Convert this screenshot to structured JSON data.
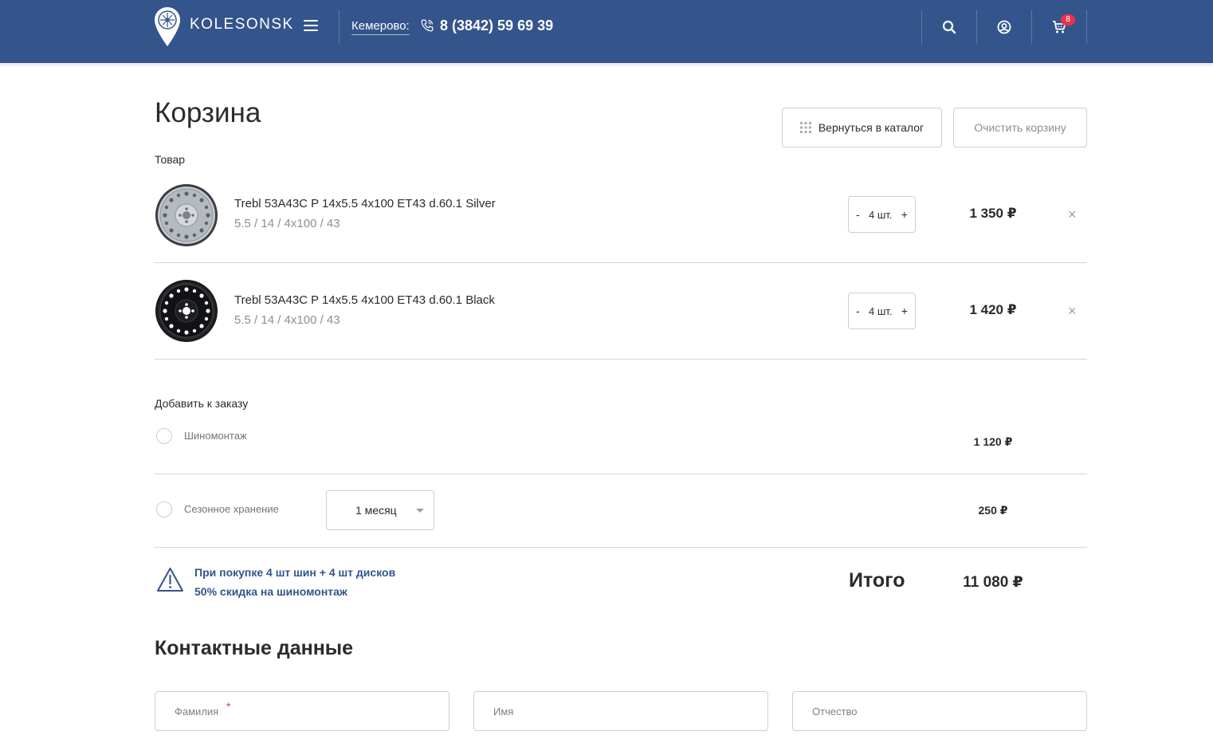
{
  "header": {
    "logo_text": "KOLESONSK",
    "city": "Кемерово:",
    "phone": "8 (3842) 59 69 39",
    "cart_count": "8"
  },
  "page": {
    "title": "Корзина",
    "back_button": "Вернуться в каталог",
    "clear_button": "Очистить корзину",
    "column_header": "Товар"
  },
  "cart_items": [
    {
      "name": "Trebl 53A43C P 14x5.5 4x100 ET43 d.60.1 Silver",
      "spec": "5.5 / 14 / 4x100 / 43",
      "qty": "4 шт.",
      "price": "1 350 ₽",
      "remove": "×",
      "minus": "-",
      "plus": "+",
      "finish": "silver"
    },
    {
      "name": "Trebl 53A43C P 14x5.5 4x100 ET43 d.60.1 Black",
      "spec": "5.5 / 14 / 4x100 / 43",
      "qty": "4 шт.",
      "price": "1 420 ₽",
      "remove": "×",
      "minus": "-",
      "plus": "+",
      "finish": "black"
    }
  ],
  "extras": {
    "heading": "Добавить к заказу",
    "services": [
      {
        "label": "Шиномонтаж",
        "price": "1 120 ₽",
        "checked": false
      },
      {
        "label": "Сезонное хранение",
        "price": "250 ₽",
        "checked": false,
        "period": "1 месяц"
      }
    ]
  },
  "promo": {
    "line1": "При покупке 4 шт шин + 4 шт дисков",
    "line2": "50% скидка на шиномонтаж"
  },
  "total": {
    "label": "Итого",
    "value": "11 080 ₽"
  },
  "contacts": {
    "title": "Контактные данные",
    "fields": [
      {
        "placeholder": "Фамилия",
        "required_mark": "*"
      },
      {
        "placeholder": "Имя"
      },
      {
        "placeholder": "Отчество"
      }
    ]
  },
  "colors": {
    "header_bg": "#34548c",
    "accent": "#34548c",
    "badge": "#e7344b",
    "border": "#c9ced6"
  }
}
